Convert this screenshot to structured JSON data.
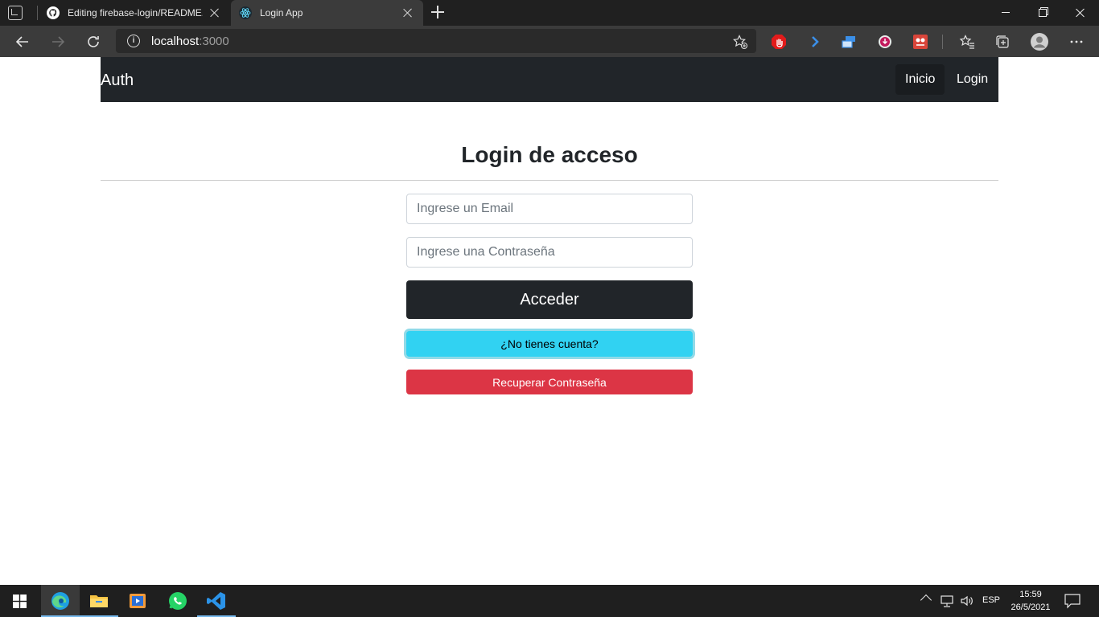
{
  "browser": {
    "tabs": [
      {
        "title": "Editing firebase-login/README.md",
        "favicon": "github-icon",
        "active": false
      },
      {
        "title": "Login App",
        "favicon": "react-icon",
        "active": true
      }
    ],
    "address": {
      "host": "localhost",
      "port": ":3000"
    }
  },
  "navbar": {
    "brand": "Auth",
    "links": [
      {
        "label": "Inicio",
        "active": true
      },
      {
        "label": "Login",
        "active": false
      }
    ]
  },
  "page": {
    "title": "Login de acceso",
    "email_placeholder": "Ingrese un Email",
    "password_placeholder": "Ingrese una Contraseña",
    "submit_label": "Acceder",
    "register_label": "¿No tienes cuenta?",
    "recover_label": "Recuperar Contraseña"
  },
  "taskbar": {
    "apps": [
      "windows-start-icon",
      "edge-icon",
      "file-explorer-icon",
      "media-player-icon",
      "whatsapp-icon",
      "vscode-icon"
    ],
    "language": "ESP",
    "time": "15:59",
    "date": "26/5/2021"
  },
  "colors": {
    "navbar_bg": "#212529",
    "btn_dark": "#212529",
    "btn_info": "#31d2f2",
    "btn_danger": "#dc3545"
  }
}
